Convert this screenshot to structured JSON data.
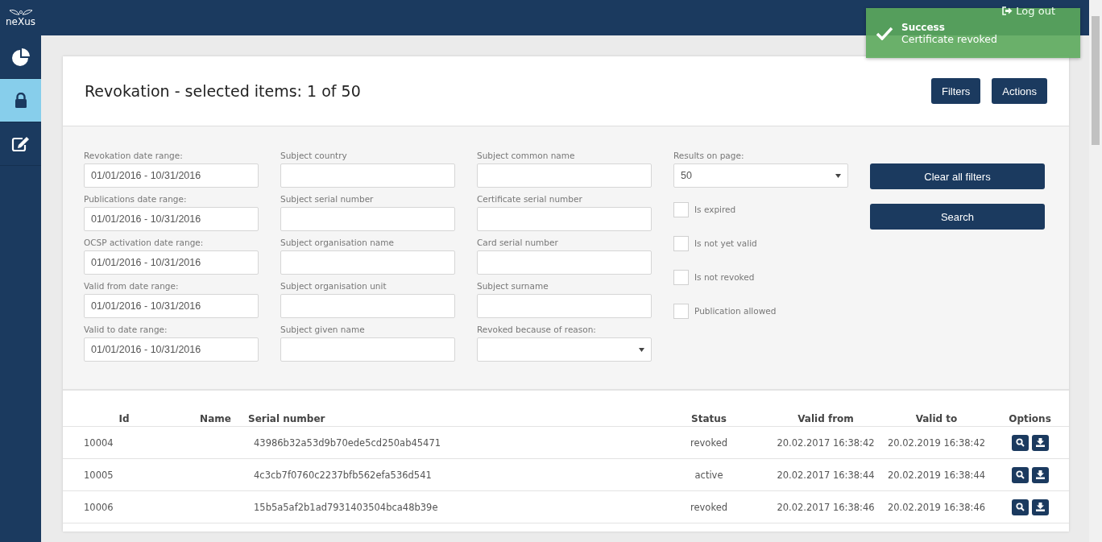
{
  "brand": {
    "name": "neXus"
  },
  "sidebar": {
    "items": [
      {
        "kind": "chart",
        "selected": false
      },
      {
        "kind": "lock",
        "selected": true
      },
      {
        "kind": "edit",
        "selected": false
      }
    ]
  },
  "topbar": {
    "logout": "Log out"
  },
  "toast": {
    "title": "Success",
    "message": "Certificate revoked"
  },
  "header": {
    "title": "Revokation - selected items: 1 of 50",
    "buttons": [
      "Filters",
      "Actions"
    ]
  },
  "filters": {
    "columns": [
      [
        {
          "kind": "text",
          "label": "Revokation date range:",
          "value": "01/01/2016 - 10/31/2016"
        },
        {
          "kind": "text",
          "label": "Publications date range:",
          "value": "01/01/2016 - 10/31/2016"
        },
        {
          "kind": "text",
          "label": "OCSP activation date range:",
          "value": "01/01/2016 - 10/31/2016"
        },
        {
          "kind": "text",
          "label": "Valid from date range:",
          "value": "01/01/2016 - 10/31/2016"
        },
        {
          "kind": "text",
          "label": "Valid to date range:",
          "value": "01/01/2016 - 10/31/2016"
        }
      ],
      [
        {
          "kind": "text",
          "label": "Subject country"
        },
        {
          "kind": "text",
          "label": "Subject serial number"
        },
        {
          "kind": "text",
          "label": "Subject organisation name"
        },
        {
          "kind": "text",
          "label": "Subject organisation unit"
        },
        {
          "kind": "text",
          "label": "Subject given name"
        }
      ],
      [
        {
          "kind": "text",
          "label": "Subject common name"
        },
        {
          "kind": "text",
          "label": "Certificate serial number"
        },
        {
          "kind": "text",
          "label": "Card serial number"
        },
        {
          "kind": "text",
          "label": "Subject surname"
        },
        {
          "kind": "select",
          "label": "Revoked because of reason:"
        }
      ],
      [
        {
          "kind": "select",
          "label": "Results on page:",
          "value": "50"
        },
        {
          "kind": "checkbox",
          "label": "Is expired",
          "checked": false
        },
        {
          "kind": "checkbox",
          "label": "Is not yet valid",
          "checked": false
        },
        {
          "kind": "checkbox",
          "label": "Is not revoked",
          "checked": false
        },
        {
          "kind": "checkbox",
          "label": "Publication allowed",
          "checked": false
        }
      ]
    ],
    "buttons": [
      "Clear all filters",
      "Search"
    ]
  },
  "table": {
    "columns": [
      "Id",
      "Name",
      "Serial number",
      "Status",
      "Valid from",
      "Valid to",
      "Options"
    ],
    "rows": [
      {
        "id": "10004",
        "name": "",
        "serial": "43986b32a53d9b70ede5cd250ab45471",
        "status": "revoked",
        "valid_from": "20.02.2017 16:38:42",
        "valid_to": "20.02.2019 16:38:42"
      },
      {
        "id": "10005",
        "name": "",
        "serial": "4c3cb7f0760c2237bfb562efa536d541",
        "status": "active",
        "valid_from": "20.02.2017 16:38:44",
        "valid_to": "20.02.2019 16:38:44"
      },
      {
        "id": "10006",
        "name": "",
        "serial": "15b5a5af2b1ad7931403504bca48b39e",
        "status": "revoked",
        "valid_from": "20.02.2017 16:38:46",
        "valid_to": "20.02.2019 16:38:46"
      }
    ]
  }
}
